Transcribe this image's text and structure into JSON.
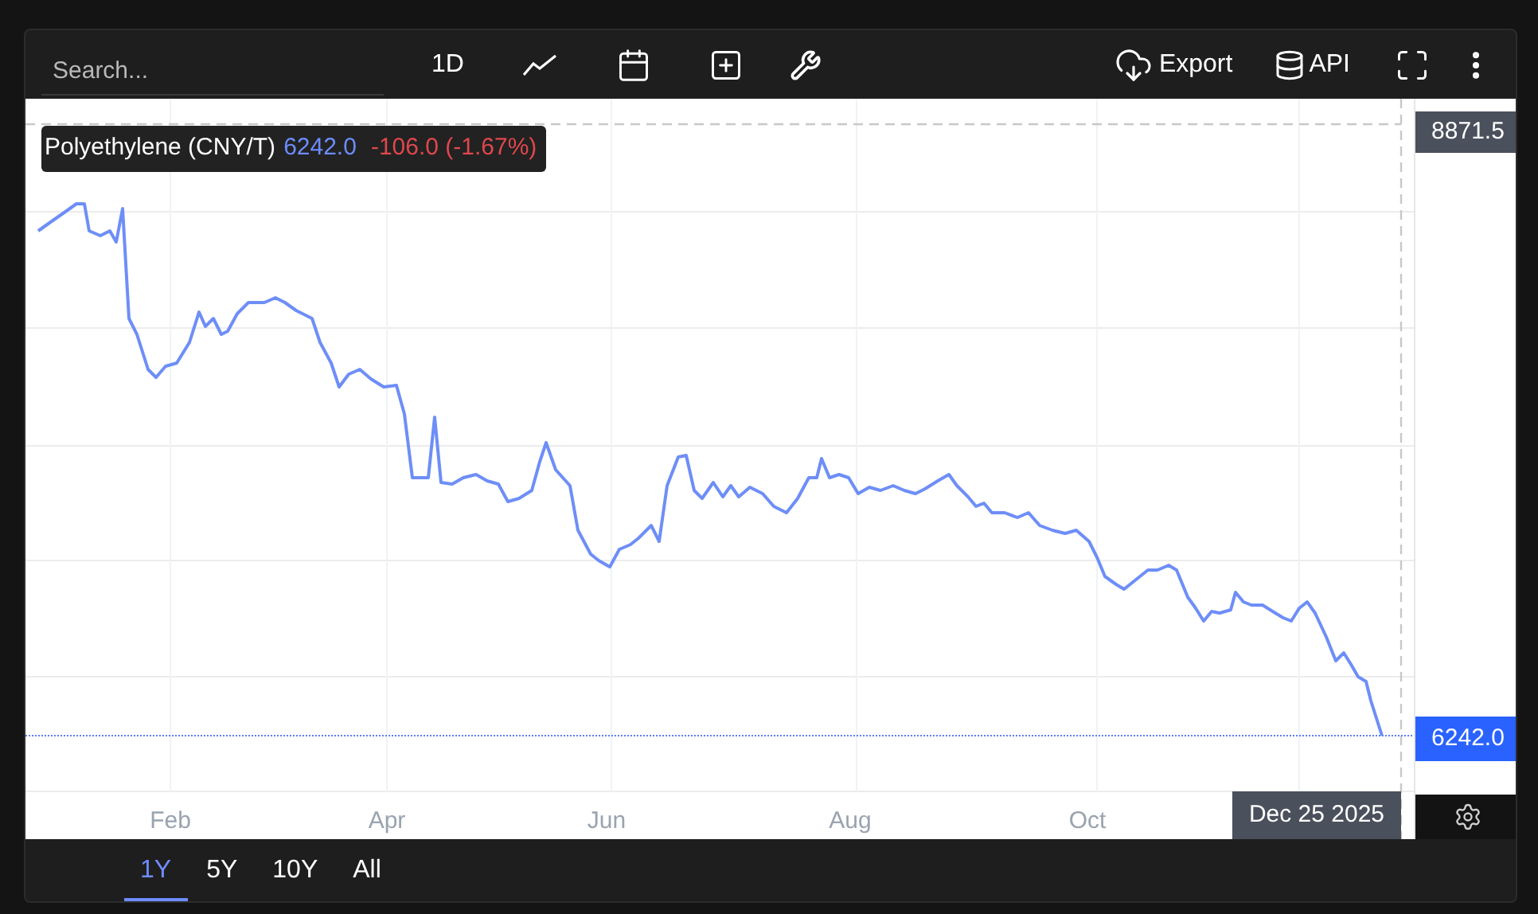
{
  "toolbar": {
    "search": {
      "placeholder": "Search..."
    },
    "interval": "1D",
    "export": "Export",
    "api": "API"
  },
  "legend": {
    "name": "Polyethylene (CNY/T)",
    "value": "6242.0",
    "change": "-106.0 (-1.67%)"
  },
  "price_axis": {
    "crosshair_price": "8871.5",
    "last_price": "6242.0"
  },
  "time_axis": {
    "labels": [
      "Feb",
      "Apr",
      "Jun",
      "Aug",
      "Oct"
    ],
    "crosshair_date": "Dec 25 2025"
  },
  "ranges": [
    {
      "label": "1Y",
      "selected": true
    },
    {
      "label": "5Y",
      "selected": false
    },
    {
      "label": "10Y",
      "selected": false
    },
    {
      "label": "All",
      "selected": false
    }
  ]
}
